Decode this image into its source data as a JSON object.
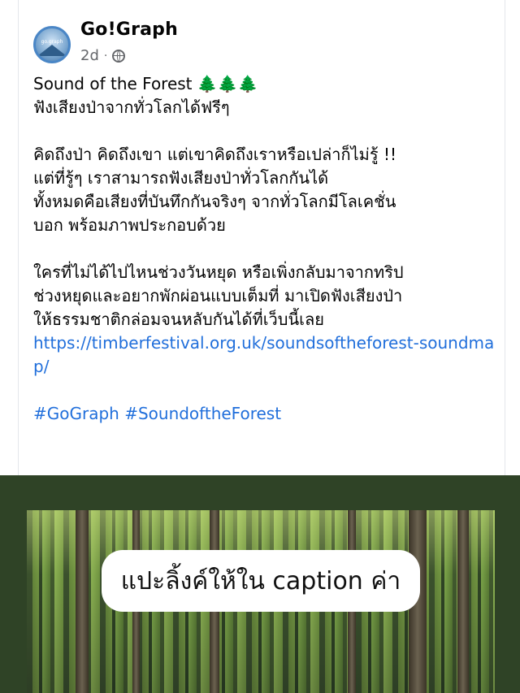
{
  "post": {
    "page_name": "Go!Graph",
    "avatar_text": "go.graph",
    "time": "2d",
    "separator": "·",
    "audience_icon": "globe-icon",
    "title": "Sound of the Forest",
    "title_emoji": "🌲🌲🌲",
    "lines": [
      "ฟังเสียงป่าจากทั่วโลกได้ฟรีๆ",
      "คิดถึงป่า คิดถึงเขา แต่เขาคิดถึงเราหรือเปล่าก็ไม่รู้ !!",
      "แต่ที่รู้ๆ เราสามารถฟังเสียงป่าทั่วโลกกันได้",
      "ทั้งหมดคือเสียงที่บันทึกกันจริงๆ จากทั่วโลกมีโลเคชั่น",
      "บอก พร้อมภาพประกอบด้วย",
      "ใครที่ไม่ได้ไปไหนช่วงวันหยุด หรือเพิ่งกลับมาจากทริป",
      "ช่วงหยุดและอยากพักผ่อนแบบเต็มที่ มาเปิดฟังเสียงป่า",
      "ให้ธรรมชาติกล่อมจนหลับกันได้ที่เว็บนี้เลย"
    ],
    "link": "https://timberfestival.org.uk/soundsoftheforest-soundmap/",
    "hashtags": "#GoGraph #SoundoftheForest"
  },
  "image": {
    "caption_overlay": "แปะลิ้งค์ให้ใน caption ค่า"
  },
  "colors": {
    "link": "#216fdb",
    "image_frame": "#2f4326",
    "meta_text": "#65676b"
  }
}
